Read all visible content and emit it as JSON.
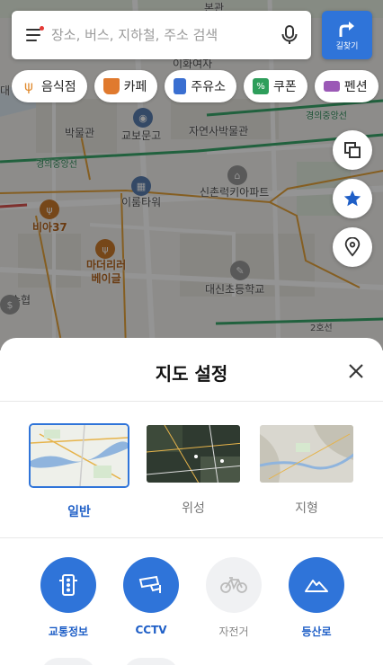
{
  "search": {
    "placeholder": "장소, 버스, 지하철, 주소 검색"
  },
  "route_button": {
    "label": "길찾기"
  },
  "categories": [
    {
      "label": "음식점",
      "icon": "fork-knife-icon",
      "color": "#e08a2e"
    },
    {
      "label": "카페",
      "icon": "coffee-cup-icon",
      "color": "#e07a2e"
    },
    {
      "label": "주유소",
      "icon": "gas-pump-icon",
      "color": "#3a6fd1"
    },
    {
      "label": "쿠폰",
      "icon": "coupon-icon",
      "color": "#2e9e5b"
    },
    {
      "label": "펜션",
      "icon": "bed-icon",
      "color": "#9b59b6"
    }
  ],
  "map_labels": {
    "bonkwan": "본관",
    "ewha": "이화여자",
    "bakmulgwan": "박물관",
    "kyobo": "교보문고",
    "natural_history": "자연사박물관",
    "gyeongui_line": "경의중앙선",
    "gyeongui_line2": "경의중앙선",
    "irum_tower": "이룸타워",
    "sinchon_rk": "신촌럭키아파트",
    "bia37": "비아37",
    "madeleine": "마더리러\n베이글",
    "daesin": "대신초등학교",
    "suhyeop": "수협",
    "line2": "2호선",
    "da": "대"
  },
  "sheet": {
    "title": "지도 설정",
    "map_types": [
      {
        "label": "일반",
        "selected": true
      },
      {
        "label": "위성",
        "selected": false
      },
      {
        "label": "지형",
        "selected": false
      }
    ],
    "layers": [
      {
        "label": "교통정보",
        "icon": "traffic-light-icon",
        "on": true
      },
      {
        "label": "CCTV",
        "icon": "cctv-icon",
        "on": true
      },
      {
        "label": "자전거",
        "icon": "bicycle-icon",
        "on": false
      },
      {
        "label": "등산로",
        "icon": "mountain-icon",
        "on": true
      }
    ]
  },
  "colors": {
    "accent": "#2f74d9",
    "accent_text": "#1f5fc7"
  }
}
